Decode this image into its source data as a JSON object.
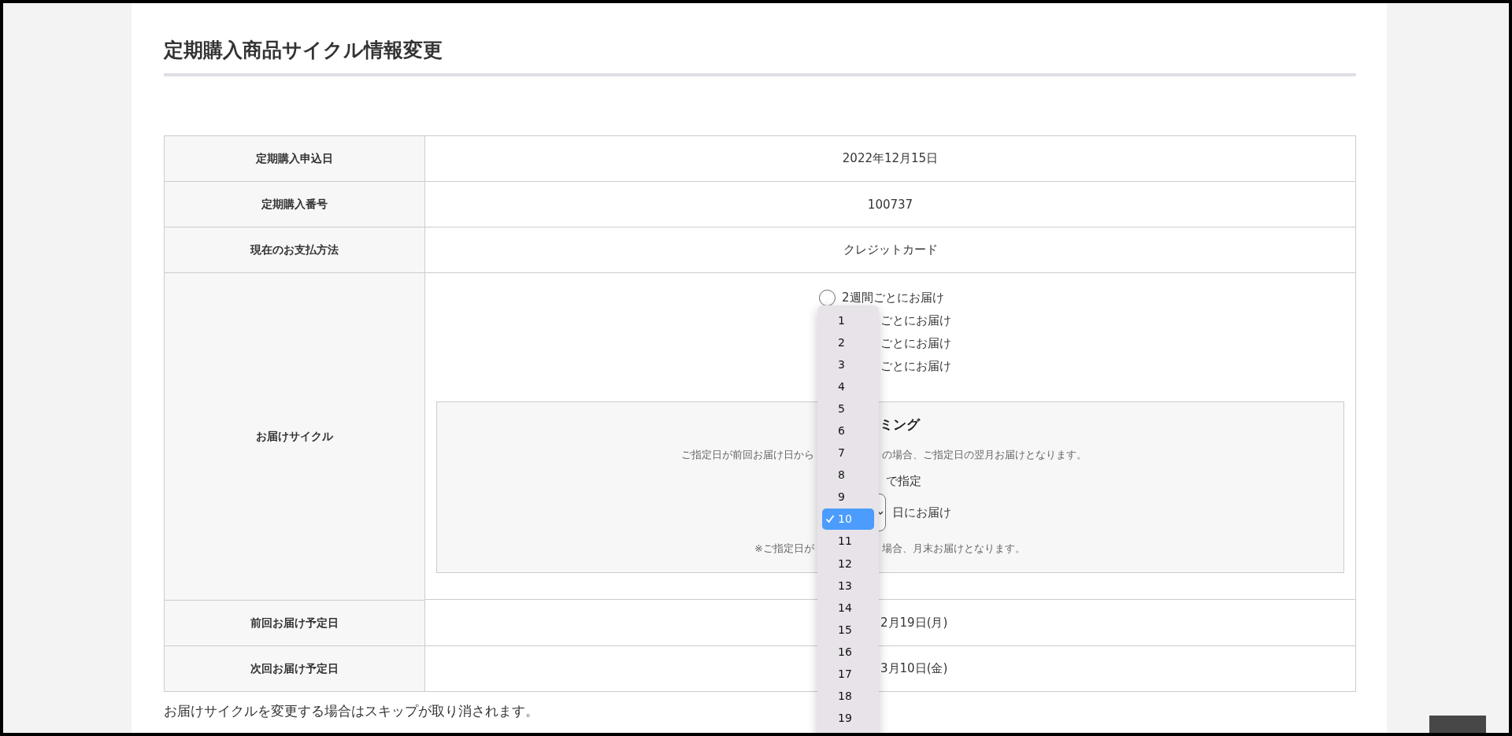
{
  "page_title": "定期購入商品サイクル情報変更",
  "rows": [
    {
      "kind": "text",
      "label": "定期購入申込日",
      "value": "2022年12月15日"
    },
    {
      "kind": "text",
      "label": "定期購入番号",
      "value": "100737"
    },
    {
      "kind": "text",
      "label": "現在のお支払方法",
      "value": "クレジットカード"
    },
    {
      "kind": "cycle",
      "label": "お届けサイクル"
    },
    {
      "kind": "partial",
      "label": "前回お届け予定日",
      "value": "2月19日(月)"
    },
    {
      "kind": "partial",
      "label": "次回お届け予定日",
      "value": "3月10日(金)"
    }
  ],
  "cycle_options": [
    {
      "kind": "radio",
      "label": "2週間ごとにお届け",
      "selected": false
    },
    {
      "kind": "text",
      "label": "ごとにお届け"
    },
    {
      "kind": "text",
      "label": "ごとにお届け"
    },
    {
      "kind": "text",
      "label": "ごとにお届け"
    }
  ],
  "timing": {
    "title": "ミング",
    "note_left": "ご指定日が前回お届け日から",
    "note_right": "の場合、ご指定日の翌月お届けとなります。",
    "method": "で指定",
    "suffix": "日にお届け",
    "footnote_left": "※ご指定日が",
    "footnote_right": "場合、月末お届けとなります。"
  },
  "day_menu": [
    {
      "label": "1",
      "selected": false
    },
    {
      "label": "2",
      "selected": false
    },
    {
      "label": "3",
      "selected": false
    },
    {
      "label": "4",
      "selected": false
    },
    {
      "label": "5",
      "selected": false
    },
    {
      "label": "6",
      "selected": false
    },
    {
      "label": "7",
      "selected": false
    },
    {
      "label": "8",
      "selected": false
    },
    {
      "label": "9",
      "selected": false
    },
    {
      "label": "10",
      "selected": true
    },
    {
      "label": "11",
      "selected": false
    },
    {
      "label": "12",
      "selected": false
    },
    {
      "label": "13",
      "selected": false
    },
    {
      "label": "14",
      "selected": false
    },
    {
      "label": "15",
      "selected": false
    },
    {
      "label": "16",
      "selected": false
    },
    {
      "label": "17",
      "selected": false
    },
    {
      "label": "18",
      "selected": false
    },
    {
      "label": "19",
      "selected": false
    }
  ],
  "footer_note": "お届けサイクルを変更する場合はスキップが取り消されます。"
}
